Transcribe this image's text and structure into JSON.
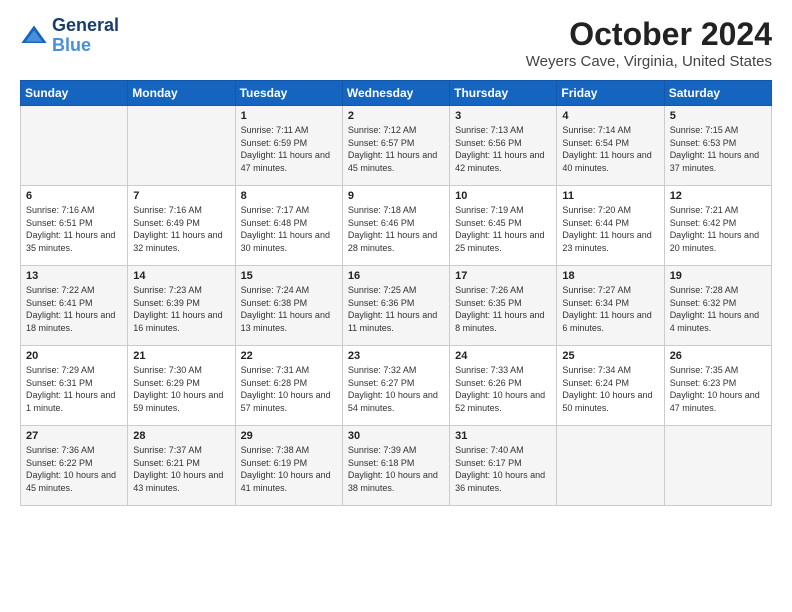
{
  "header": {
    "logo_line1": "General",
    "logo_line2": "Blue",
    "title": "October 2024",
    "subtitle": "Weyers Cave, Virginia, United States"
  },
  "columns": [
    "Sunday",
    "Monday",
    "Tuesday",
    "Wednesday",
    "Thursday",
    "Friday",
    "Saturday"
  ],
  "rows": [
    [
      {
        "day": "",
        "info": ""
      },
      {
        "day": "",
        "info": ""
      },
      {
        "day": "1",
        "info": "Sunrise: 7:11 AM\nSunset: 6:59 PM\nDaylight: 11 hours\nand 47 minutes."
      },
      {
        "day": "2",
        "info": "Sunrise: 7:12 AM\nSunset: 6:57 PM\nDaylight: 11 hours\nand 45 minutes."
      },
      {
        "day": "3",
        "info": "Sunrise: 7:13 AM\nSunset: 6:56 PM\nDaylight: 11 hours\nand 42 minutes."
      },
      {
        "day": "4",
        "info": "Sunrise: 7:14 AM\nSunset: 6:54 PM\nDaylight: 11 hours\nand 40 minutes."
      },
      {
        "day": "5",
        "info": "Sunrise: 7:15 AM\nSunset: 6:53 PM\nDaylight: 11 hours\nand 37 minutes."
      }
    ],
    [
      {
        "day": "6",
        "info": "Sunrise: 7:16 AM\nSunset: 6:51 PM\nDaylight: 11 hours\nand 35 minutes."
      },
      {
        "day": "7",
        "info": "Sunrise: 7:16 AM\nSunset: 6:49 PM\nDaylight: 11 hours\nand 32 minutes."
      },
      {
        "day": "8",
        "info": "Sunrise: 7:17 AM\nSunset: 6:48 PM\nDaylight: 11 hours\nand 30 minutes."
      },
      {
        "day": "9",
        "info": "Sunrise: 7:18 AM\nSunset: 6:46 PM\nDaylight: 11 hours\nand 28 minutes."
      },
      {
        "day": "10",
        "info": "Sunrise: 7:19 AM\nSunset: 6:45 PM\nDaylight: 11 hours\nand 25 minutes."
      },
      {
        "day": "11",
        "info": "Sunrise: 7:20 AM\nSunset: 6:44 PM\nDaylight: 11 hours\nand 23 minutes."
      },
      {
        "day": "12",
        "info": "Sunrise: 7:21 AM\nSunset: 6:42 PM\nDaylight: 11 hours\nand 20 minutes."
      }
    ],
    [
      {
        "day": "13",
        "info": "Sunrise: 7:22 AM\nSunset: 6:41 PM\nDaylight: 11 hours\nand 18 minutes."
      },
      {
        "day": "14",
        "info": "Sunrise: 7:23 AM\nSunset: 6:39 PM\nDaylight: 11 hours\nand 16 minutes."
      },
      {
        "day": "15",
        "info": "Sunrise: 7:24 AM\nSunset: 6:38 PM\nDaylight: 11 hours\nand 13 minutes."
      },
      {
        "day": "16",
        "info": "Sunrise: 7:25 AM\nSunset: 6:36 PM\nDaylight: 11 hours\nand 11 minutes."
      },
      {
        "day": "17",
        "info": "Sunrise: 7:26 AM\nSunset: 6:35 PM\nDaylight: 11 hours\nand 8 minutes."
      },
      {
        "day": "18",
        "info": "Sunrise: 7:27 AM\nSunset: 6:34 PM\nDaylight: 11 hours\nand 6 minutes."
      },
      {
        "day": "19",
        "info": "Sunrise: 7:28 AM\nSunset: 6:32 PM\nDaylight: 11 hours\nand 4 minutes."
      }
    ],
    [
      {
        "day": "20",
        "info": "Sunrise: 7:29 AM\nSunset: 6:31 PM\nDaylight: 11 hours\nand 1 minute."
      },
      {
        "day": "21",
        "info": "Sunrise: 7:30 AM\nSunset: 6:29 PM\nDaylight: 10 hours\nand 59 minutes."
      },
      {
        "day": "22",
        "info": "Sunrise: 7:31 AM\nSunset: 6:28 PM\nDaylight: 10 hours\nand 57 minutes."
      },
      {
        "day": "23",
        "info": "Sunrise: 7:32 AM\nSunset: 6:27 PM\nDaylight: 10 hours\nand 54 minutes."
      },
      {
        "day": "24",
        "info": "Sunrise: 7:33 AM\nSunset: 6:26 PM\nDaylight: 10 hours\nand 52 minutes."
      },
      {
        "day": "25",
        "info": "Sunrise: 7:34 AM\nSunset: 6:24 PM\nDaylight: 10 hours\nand 50 minutes."
      },
      {
        "day": "26",
        "info": "Sunrise: 7:35 AM\nSunset: 6:23 PM\nDaylight: 10 hours\nand 47 minutes."
      }
    ],
    [
      {
        "day": "27",
        "info": "Sunrise: 7:36 AM\nSunset: 6:22 PM\nDaylight: 10 hours\nand 45 minutes."
      },
      {
        "day": "28",
        "info": "Sunrise: 7:37 AM\nSunset: 6:21 PM\nDaylight: 10 hours\nand 43 minutes."
      },
      {
        "day": "29",
        "info": "Sunrise: 7:38 AM\nSunset: 6:19 PM\nDaylight: 10 hours\nand 41 minutes."
      },
      {
        "day": "30",
        "info": "Sunrise: 7:39 AM\nSunset: 6:18 PM\nDaylight: 10 hours\nand 38 minutes."
      },
      {
        "day": "31",
        "info": "Sunrise: 7:40 AM\nSunset: 6:17 PM\nDaylight: 10 hours\nand 36 minutes."
      },
      {
        "day": "",
        "info": ""
      },
      {
        "day": "",
        "info": ""
      }
    ]
  ]
}
